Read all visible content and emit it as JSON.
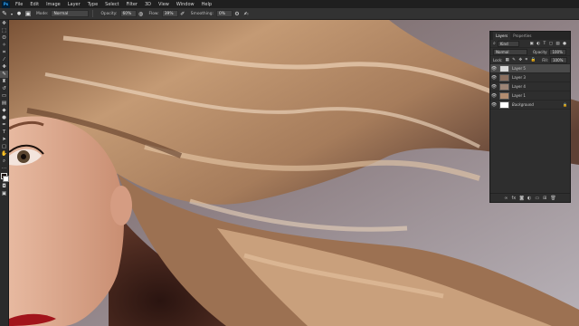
{
  "app": {
    "logo_text": "Ps"
  },
  "menu": [
    "File",
    "Edit",
    "Image",
    "Layer",
    "Type",
    "Select",
    "Filter",
    "3D",
    "View",
    "Window",
    "Help"
  ],
  "options_bar": {
    "mode_label": "Mode:",
    "mode_value": "Normal",
    "opacity_label": "Opacity:",
    "opacity_value": "60%",
    "flow_label": "Flow:",
    "flow_value": "39%",
    "smoothing_label": "Smoothing:",
    "smoothing_value": "0%"
  },
  "tools": [
    "move-icon",
    "marquee-icon",
    "lasso-icon",
    "quick-select-icon",
    "crop-icon",
    "eyedropper-icon",
    "healing-icon",
    "brush-icon",
    "clone-stamp-icon",
    "history-brush-icon",
    "eraser-icon",
    "gradient-icon",
    "blur-icon",
    "dodge-icon",
    "pen-icon",
    "type-icon",
    "path-select-icon",
    "rectangle-icon",
    "hand-icon",
    "zoom-icon"
  ],
  "colors": {
    "foreground": "#1a0f0b",
    "background": "#ffffff",
    "accent": "#31a8ff"
  },
  "layers_panel": {
    "tab_layers": "Layers",
    "tab_properties": "Properties",
    "filter_label": "Kind",
    "blend_mode": "Normal",
    "opacity_label": "Opacity:",
    "opacity_value": "100%",
    "lock_label": "Lock:",
    "fill_label": "Fill:",
    "fill_value": "100%",
    "layers": [
      {
        "name": "Layer 5",
        "selected": true
      },
      {
        "name": "Layer 3",
        "selected": false
      },
      {
        "name": "Layer 4",
        "selected": false
      },
      {
        "name": "Layer 1",
        "selected": false
      },
      {
        "name": "Background",
        "selected": false
      }
    ]
  }
}
